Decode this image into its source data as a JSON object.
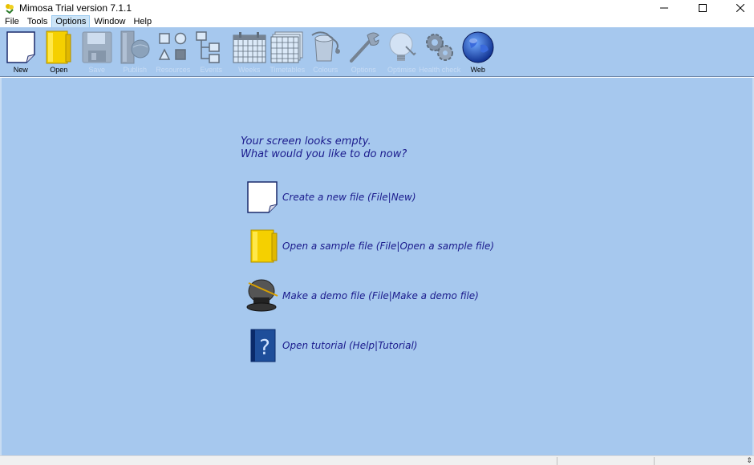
{
  "window": {
    "title": "Mimosa Trial version 7.1.1",
    "minimize_glyph": "—",
    "maximize_glyph": "☐",
    "close_glyph": "✕"
  },
  "menu": {
    "items": [
      {
        "label": "File"
      },
      {
        "label": "Tools"
      },
      {
        "label": "Options",
        "active": true
      },
      {
        "label": "Window"
      },
      {
        "label": "Help"
      }
    ]
  },
  "toolbar": {
    "items": [
      {
        "label": "New",
        "icon": "new-file-icon",
        "enabled": true
      },
      {
        "label": "Open",
        "icon": "folder-icon",
        "enabled": true
      },
      {
        "label": "Save",
        "icon": "floppy-disk-icon",
        "enabled": false
      },
      {
        "label": "Publish",
        "icon": "publish-icon",
        "enabled": false
      },
      {
        "label": "Resources",
        "icon": "shapes-icon",
        "enabled": false
      },
      {
        "label": "Events",
        "icon": "tree-diagram-icon",
        "enabled": false
      },
      {
        "label": "Weeks",
        "icon": "calendar-icon",
        "enabled": false
      },
      {
        "label": "Timetables",
        "icon": "timetable-grid-icon",
        "enabled": false
      },
      {
        "label": "Colours",
        "icon": "paint-bucket-icon",
        "enabled": false
      },
      {
        "label": "Options",
        "icon": "wrench-icon",
        "enabled": false
      },
      {
        "label": "Optimise",
        "icon": "lightbulb-icon",
        "enabled": false
      },
      {
        "label": "Health check",
        "icon": "gears-icon",
        "enabled": false
      },
      {
        "label": "Web",
        "icon": "globe-icon",
        "enabled": true
      }
    ]
  },
  "main": {
    "empty_line1": "Your screen looks empty.",
    "empty_line2": "What would you like to do now?",
    "actions": [
      {
        "label": "Create a new file (File|New)",
        "icon": "new-file-icon"
      },
      {
        "label": "Open a sample file (File|Open a sample file)",
        "icon": "folder-icon"
      },
      {
        "label": "Make a demo file (File|Make a demo file)",
        "icon": "magic-hat-icon"
      },
      {
        "label": "Open tutorial (Help|Tutorial)",
        "icon": "help-book-icon"
      }
    ]
  },
  "colors": {
    "workspace": "#a6c8ee",
    "link_text": "#1a1a8c"
  }
}
